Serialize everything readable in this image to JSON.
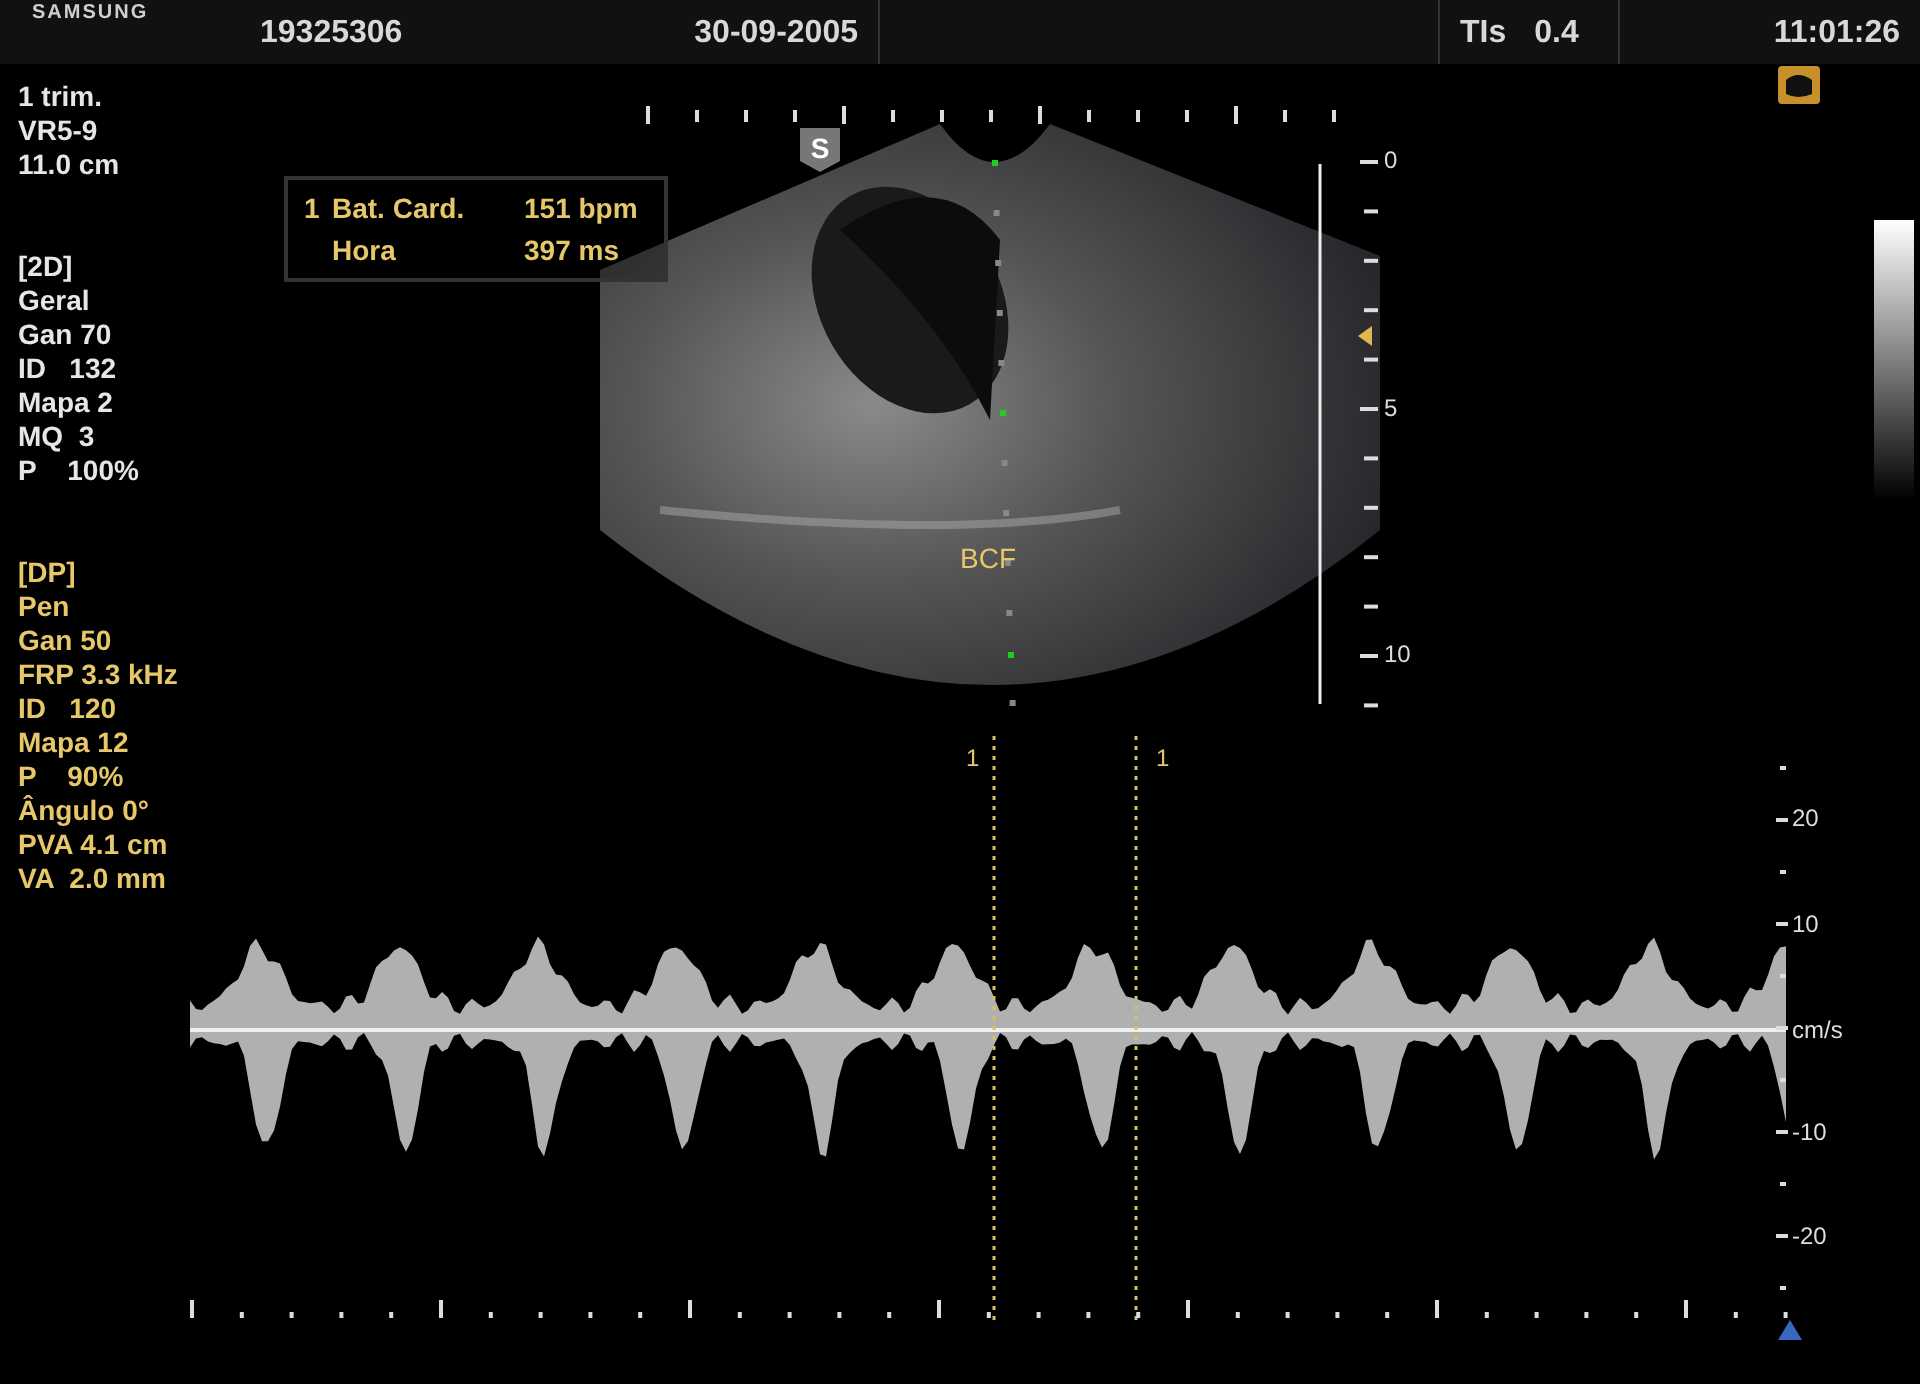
{
  "header": {
    "logo": "SAMSUNG",
    "patient_id": "19325306",
    "date": "30-09-2005",
    "tis_label": "TIs",
    "tis_value": "0.4",
    "time": "11:01:26"
  },
  "probe": [
    "1 trim.",
    "VR5-9",
    "11.0 cm"
  ],
  "params_2d": [
    "[2D]",
    "Geral",
    "Gan 70",
    "ID   132",
    "Mapa 2",
    "MQ  3",
    "P    100%"
  ],
  "params_dp": [
    "[DP]",
    "Pen",
    "Gan 50",
    "FRP 3.3 kHz",
    "ID   120",
    "Mapa 12",
    "P    90%",
    "Ângulo 0°",
    "PVA 4.1 cm",
    "VA  2.0 mm"
  ],
  "measurement": {
    "index": "1",
    "rows": [
      {
        "label": "Bat. Card.",
        "value": "151 bpm"
      },
      {
        "label": "Hora",
        "value": "397 ms"
      }
    ]
  },
  "image": {
    "marker": "S",
    "label": "BCF"
  },
  "depth_scale": [
    "0",
    "5",
    "10"
  ],
  "cursor_labels": [
    "1",
    "1"
  ],
  "velocity_scale": {
    "ticks": [
      "20",
      "10",
      "-10",
      "-20"
    ],
    "unit": "cm/s"
  }
}
